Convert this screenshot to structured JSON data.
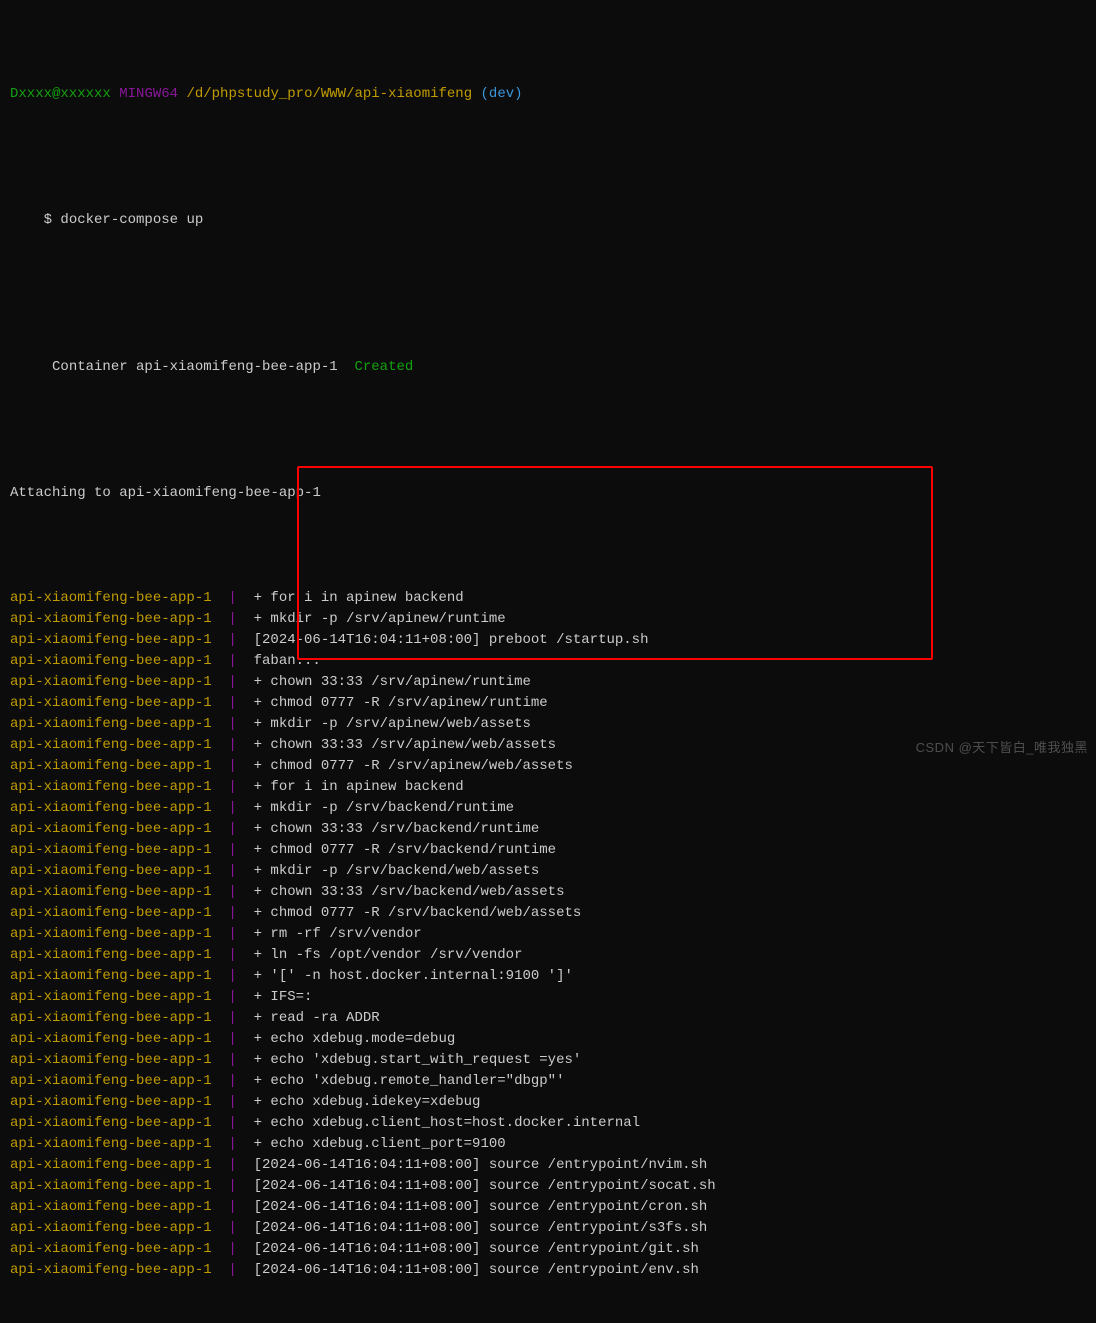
{
  "prompt_line": {
    "user_host": "Dxxxx@xxxxxx",
    "sep1": " ",
    "tool": "MINGW64",
    "sep2": " ",
    "path": "/d/phpstudy_pro/WWW/api-xiaomifeng",
    "branch": "(dev)"
  },
  "cmd_prompt_symbol": "$ ",
  "cmd": "docker-compose up",
  "created_line_left": " Container api-xiaomifeng-bee-app-1  ",
  "created_line_right": "Created",
  "attaching_line": "Attaching to api-xiaomifeng-bee-app-1",
  "container_name": "api-xiaomifeng-bee-app-1",
  "separator": "  |  ",
  "logs": [
    "+ for i in apinew backend",
    "+ mkdir -p /srv/apinew/runtime",
    "[2024-06-14T16:04:11+08:00] preboot /startup.sh",
    "faban...",
    "+ chown 33:33 /srv/apinew/runtime",
    "+ chmod 0777 -R /srv/apinew/runtime",
    "+ mkdir -p /srv/apinew/web/assets",
    "+ chown 33:33 /srv/apinew/web/assets",
    "+ chmod 0777 -R /srv/apinew/web/assets",
    "+ for i in apinew backend",
    "+ mkdir -p /srv/backend/runtime",
    "+ chown 33:33 /srv/backend/runtime",
    "+ chmod 0777 -R /srv/backend/runtime",
    "+ mkdir -p /srv/backend/web/assets",
    "+ chown 33:33 /srv/backend/web/assets",
    "+ chmod 0777 -R /srv/backend/web/assets",
    "+ rm -rf /srv/vendor",
    "+ ln -fs /opt/vendor /srv/vendor",
    "+ '[' -n host.docker.internal:9100 ']'",
    "+ IFS=:",
    "+ read -ra ADDR",
    "+ echo xdebug.mode=debug",
    "+ echo 'xdebug.start_with_request =yes'",
    "+ echo 'xdebug.remote_handler=\"dbgp\"'",
    "+ echo xdebug.idekey=xdebug",
    "+ echo xdebug.client_host=host.docker.internal",
    "+ echo xdebug.client_port=9100",
    "[2024-06-14T16:04:11+08:00] source /entrypoint/nvim.sh",
    "[2024-06-14T16:04:11+08:00] source /entrypoint/socat.sh",
    "[2024-06-14T16:04:11+08:00] source /entrypoint/cron.sh",
    "[2024-06-14T16:04:11+08:00] source /entrypoint/s3fs.sh",
    "[2024-06-14T16:04:11+08:00] source /entrypoint/git.sh",
    "[2024-06-14T16:04:11+08:00] source /entrypoint/env.sh"
  ],
  "watermark": "CSDN @天下皆白_唯我独黑"
}
